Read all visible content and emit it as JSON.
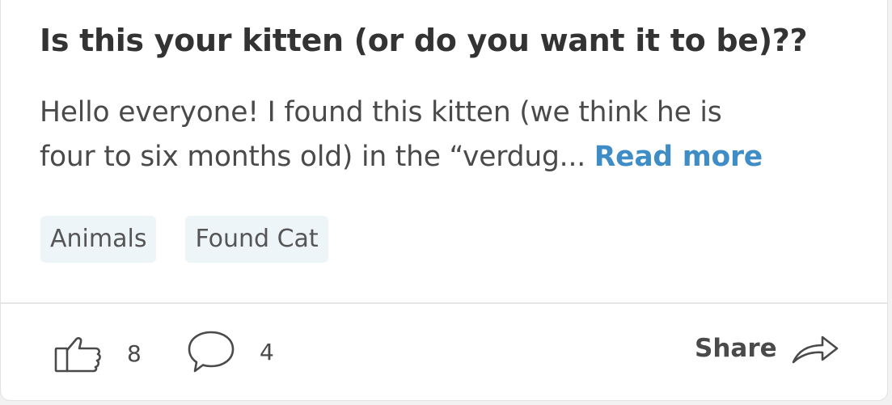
{
  "post": {
    "title": "Is this your kitten (or do you want it to be)??",
    "body_line1": "Hello everyone! I found this kitten (we think he is",
    "body_line2": "four to six months old) in the “verdug... ",
    "read_more_label": "Read more",
    "tags": [
      "Animals",
      "Found Cat"
    ]
  },
  "footer": {
    "like_icon": "thumbs-up-icon",
    "like_count": "8",
    "comment_icon": "speech-bubble-icon",
    "comment_count": "4",
    "share_label": "Share",
    "share_icon": "share-arrow-icon"
  },
  "colors": {
    "accent": "#3f8dc6",
    "title": "#333333",
    "text": "#4a4a4a",
    "tag_bg": "#eef5f9"
  }
}
